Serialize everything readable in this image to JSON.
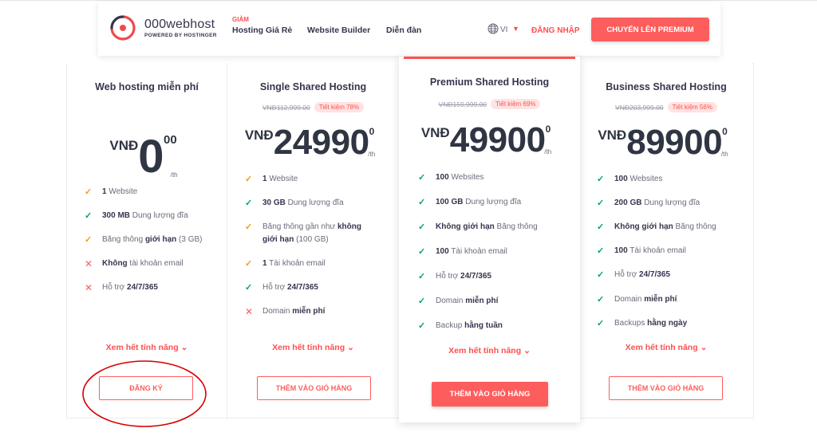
{
  "header": {
    "logo_name": "000webhost",
    "logo_sub": "POWERED BY HOSTINGER",
    "nav": [
      {
        "badge": "GIẢM",
        "label": "Hosting Giá Rẻ"
      },
      {
        "label": "Website Builder"
      },
      {
        "label": "Diễn đàn"
      }
    ],
    "language": "VI",
    "login": "ĐĂNG NHẬP",
    "premium_button": "CHUYỂN LÊN PREMIUM"
  },
  "plans": [
    {
      "title": "Web hosting miễn phí",
      "currency": "VNĐ",
      "amount": "0",
      "decimal": "00",
      "per": "/th",
      "features": [
        {
          "icon": "warn",
          "bold": "1",
          "text": " Website"
        },
        {
          "icon": "check",
          "bold": "300 MB",
          "text": " Dung lượng đĩa"
        },
        {
          "icon": "warn",
          "pre": "Băng thông ",
          "bold": "giới hạn",
          "text": " (3 GB)"
        },
        {
          "icon": "cross",
          "bold": "Không",
          "text": " tài khoản email"
        },
        {
          "icon": "cross",
          "pre": "Hỗ trợ ",
          "bold": "24/7/365",
          "text": ""
        }
      ],
      "more": "Xem hết tính năng",
      "button": "ĐĂNG KÝ"
    },
    {
      "title": "Single Shared Hosting",
      "old_price": "VNĐ112,999.00",
      "save": "Tiết kiệm 78%",
      "currency": "VNĐ",
      "amount": "24990",
      "decimal": "0",
      "per": "/th",
      "features": [
        {
          "icon": "warn",
          "bold": "1",
          "text": " Website"
        },
        {
          "icon": "check",
          "bold": "30 GB",
          "text": " Dung lượng đĩa"
        },
        {
          "icon": "warn",
          "pre": "Băng thông gần như ",
          "bold": "không giới hạn",
          "text": " (100 GB)"
        },
        {
          "icon": "warn",
          "bold": "1",
          "text": " Tài khoản email"
        },
        {
          "icon": "check",
          "pre": "Hỗ trợ ",
          "bold": "24/7/365",
          "text": ""
        },
        {
          "icon": "cross",
          "pre": "Domain ",
          "bold": "miễn phí",
          "text": ""
        }
      ],
      "more": "Xem hết tính năng",
      "button": "THÊM VÀO GIỎ HÀNG"
    },
    {
      "title": "Premium Shared Hosting",
      "old_price": "VNĐ159,999.00",
      "save": "Tiết kiệm 69%",
      "currency": "VNĐ",
      "amount": "49900",
      "decimal": "0",
      "per": "/th",
      "features": [
        {
          "icon": "check",
          "bold": "100",
          "text": " Websites"
        },
        {
          "icon": "check",
          "bold": "100 GB",
          "text": " Dung lượng đĩa"
        },
        {
          "icon": "check",
          "bold": "Không giới hạn",
          "text": " Băng thông"
        },
        {
          "icon": "check",
          "bold": "100",
          "text": " Tài khoản email"
        },
        {
          "icon": "check",
          "pre": "Hỗ trợ ",
          "bold": "24/7/365",
          "text": ""
        },
        {
          "icon": "check",
          "pre": "Domain ",
          "bold": "miễn phí",
          "text": ""
        },
        {
          "icon": "check",
          "pre": "Backup ",
          "bold": "hằng tuần",
          "text": ""
        }
      ],
      "more": "Xem hết tính năng",
      "button": "THÊM VÀO GIỎ HÀNG"
    },
    {
      "title": "Business Shared Hosting",
      "old_price": "VNĐ203,999.00",
      "save": "Tiết kiệm 56%",
      "currency": "VNĐ",
      "amount": "89900",
      "decimal": "0",
      "per": "/th",
      "features": [
        {
          "icon": "check",
          "bold": "100",
          "text": " Websites"
        },
        {
          "icon": "check",
          "bold": "200 GB",
          "text": " Dung lượng đĩa"
        },
        {
          "icon": "check",
          "bold": "Không giới hạn",
          "text": " Băng thông"
        },
        {
          "icon": "check",
          "bold": "100",
          "text": " Tài khoản email"
        },
        {
          "icon": "check",
          "pre": "Hỗ trợ ",
          "bold": "24/7/365",
          "text": ""
        },
        {
          "icon": "check",
          "pre": "Domain ",
          "bold": "miễn phí",
          "text": ""
        },
        {
          "icon": "check",
          "pre": "Backups ",
          "bold": "hằng ngày",
          "text": ""
        }
      ],
      "more": "Xem hết tính năng",
      "button": "THÊM VÀO GIỎ HÀNG"
    }
  ],
  "colors": {
    "accent": "#fd5d5d",
    "check": "#00a85a",
    "warn": "#f39c12",
    "text": "#36344d",
    "annotation": "#d40000"
  }
}
